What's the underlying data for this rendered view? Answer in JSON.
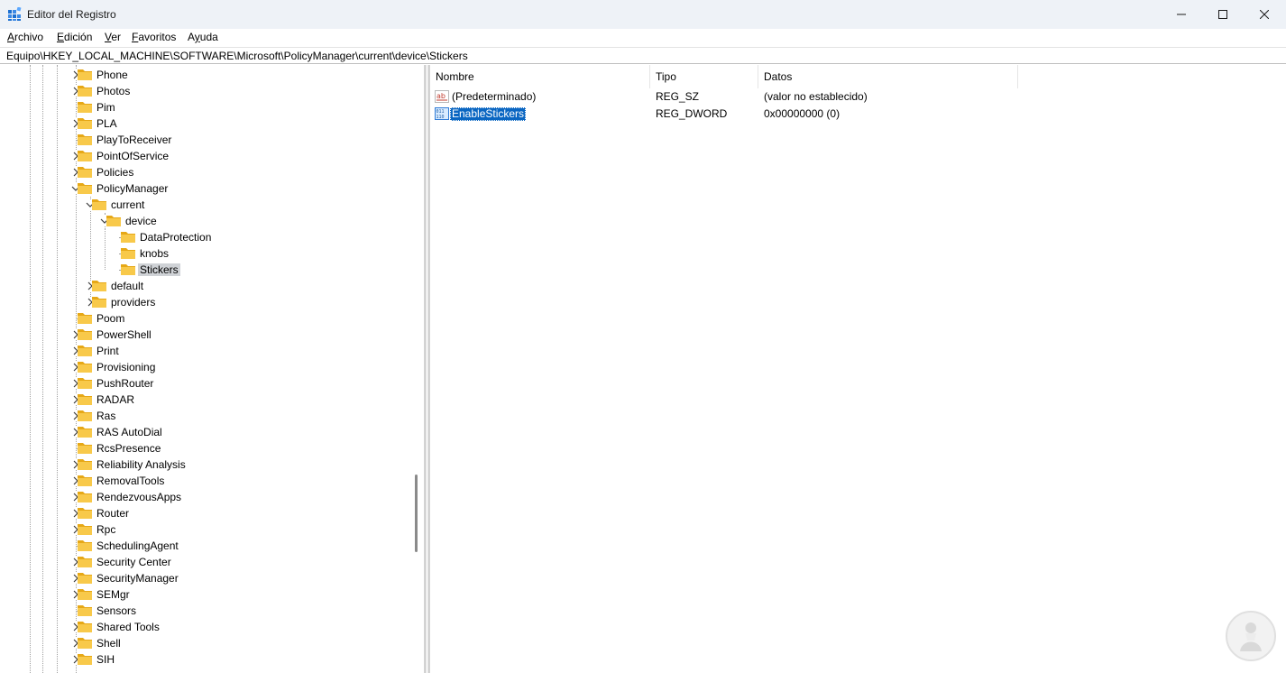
{
  "window": {
    "title": "Editor del Registro",
    "icon": "regedit-icon",
    "controls": {
      "minimize": "minimize-icon",
      "maximize": "maximize-icon",
      "close": "close-icon"
    }
  },
  "menu": {
    "items": [
      {
        "label": "Archivo",
        "accel": "A",
        "rest": "rchivo"
      },
      {
        "label": "Edición",
        "accel": "E",
        "rest": "dición"
      },
      {
        "label": "Ver",
        "accel": "V",
        "rest": "er"
      },
      {
        "label": "Favoritos",
        "accel": "F",
        "rest": "avoritos"
      },
      {
        "label": "Ayuda",
        "accel": "y",
        "pre": "A",
        "rest": "uda"
      }
    ]
  },
  "address": {
    "path": "Equipo\\HKEY_LOCAL_MACHINE\\SOFTWARE\\Microsoft\\PolicyManager\\current\\device\\Stickers"
  },
  "tree": {
    "items": [
      {
        "label": "Phone",
        "level": 0,
        "expander": "collapsed"
      },
      {
        "label": "Photos",
        "level": 0,
        "expander": "collapsed"
      },
      {
        "label": "Pim",
        "level": 0,
        "expander": "none"
      },
      {
        "label": "PLA",
        "level": 0,
        "expander": "collapsed"
      },
      {
        "label": "PlayToReceiver",
        "level": 0,
        "expander": "none"
      },
      {
        "label": "PointOfService",
        "level": 0,
        "expander": "collapsed"
      },
      {
        "label": "Policies",
        "level": 0,
        "expander": "collapsed"
      },
      {
        "label": "PolicyManager",
        "level": 0,
        "expander": "expanded"
      },
      {
        "label": "current",
        "level": 1,
        "expander": "expanded"
      },
      {
        "label": "device",
        "level": 2,
        "expander": "expanded"
      },
      {
        "label": "DataProtection",
        "level": 3,
        "expander": "none"
      },
      {
        "label": "knobs",
        "level": 3,
        "expander": "none"
      },
      {
        "label": "Stickers",
        "level": 3,
        "expander": "none",
        "selected": true
      },
      {
        "label": "default",
        "level": 1,
        "expander": "collapsed"
      },
      {
        "label": "providers",
        "level": 1,
        "expander": "collapsed"
      },
      {
        "label": "Poom",
        "level": 0,
        "expander": "none"
      },
      {
        "label": "PowerShell",
        "level": 0,
        "expander": "collapsed"
      },
      {
        "label": "Print",
        "level": 0,
        "expander": "collapsed"
      },
      {
        "label": "Provisioning",
        "level": 0,
        "expander": "collapsed"
      },
      {
        "label": "PushRouter",
        "level": 0,
        "expander": "collapsed"
      },
      {
        "label": "RADAR",
        "level": 0,
        "expander": "collapsed"
      },
      {
        "label": "Ras",
        "level": 0,
        "expander": "collapsed"
      },
      {
        "label": "RAS AutoDial",
        "level": 0,
        "expander": "collapsed"
      },
      {
        "label": "RcsPresence",
        "level": 0,
        "expander": "none"
      },
      {
        "label": "Reliability Analysis",
        "level": 0,
        "expander": "collapsed"
      },
      {
        "label": "RemovalTools",
        "level": 0,
        "expander": "collapsed"
      },
      {
        "label": "RendezvousApps",
        "level": 0,
        "expander": "collapsed"
      },
      {
        "label": "Router",
        "level": 0,
        "expander": "collapsed"
      },
      {
        "label": "Rpc",
        "level": 0,
        "expander": "collapsed"
      },
      {
        "label": "SchedulingAgent",
        "level": 0,
        "expander": "none"
      },
      {
        "label": "Security Center",
        "level": 0,
        "expander": "collapsed"
      },
      {
        "label": "SecurityManager",
        "level": 0,
        "expander": "collapsed"
      },
      {
        "label": "SEMgr",
        "level": 0,
        "expander": "collapsed"
      },
      {
        "label": "Sensors",
        "level": 0,
        "expander": "none"
      },
      {
        "label": "Shared Tools",
        "level": 0,
        "expander": "collapsed"
      },
      {
        "label": "Shell",
        "level": 0,
        "expander": "collapsed"
      },
      {
        "label": "SIH",
        "level": 0,
        "expander": "collapsed"
      }
    ]
  },
  "values_list": {
    "columns": {
      "name": "Nombre",
      "type": "Tipo",
      "data": "Datos"
    },
    "rows": [
      {
        "name": "(Predeterminado)",
        "type": "REG_SZ",
        "data": "(valor no establecido)",
        "icon": "string-value-icon",
        "selected": false
      },
      {
        "name": "EnableStickers",
        "type": "REG_DWORD",
        "data": "0x00000000 (0)",
        "icon": "dword-value-icon",
        "selected": true
      }
    ]
  },
  "colors": {
    "titlebar_bg": "#eef2f7",
    "selection_blue": "#0a66c2",
    "tree_selection": "#cfd2d6",
    "folder_yellow": "#f8c94a"
  },
  "watermark": {
    "icon": "solvetic-logo-icon"
  }
}
